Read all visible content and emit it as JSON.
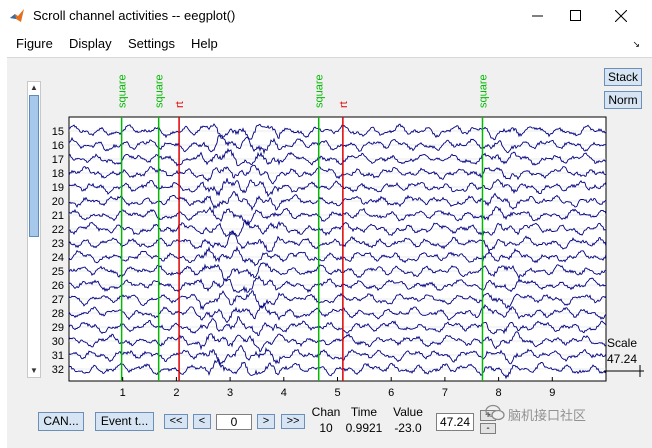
{
  "window": {
    "title": "Scroll channel activities -- eegplot()",
    "minimize_icon": "minimize-icon",
    "maximize_icon": "maximize-icon",
    "close_icon": "close-icon"
  },
  "menu": {
    "items": [
      "Figure",
      "Display",
      "Settings",
      "Help"
    ]
  },
  "side_buttons": {
    "stack": "Stack",
    "norm": "Norm"
  },
  "scale": {
    "label": "Scale",
    "value": "47.24"
  },
  "plot": {
    "channels": [
      "15",
      "16",
      "17",
      "18",
      "19",
      "20",
      "21",
      "22",
      "23",
      "24",
      "25",
      "26",
      "27",
      "28",
      "29",
      "30",
      "31",
      "32"
    ],
    "xticks": [
      "1",
      "2",
      "3",
      "4",
      "5",
      "6",
      "7",
      "8",
      "9"
    ],
    "xrange": [
      0,
      10
    ],
    "events": [
      {
        "type": "square",
        "t": 0.98,
        "color": "#00bb00"
      },
      {
        "type": "square",
        "t": 1.67,
        "color": "#00bb00"
      },
      {
        "type": "rt",
        "t": 2.05,
        "color": "#e00000"
      },
      {
        "type": "square",
        "t": 4.65,
        "color": "#00bb00"
      },
      {
        "type": "rt",
        "t": 5.1,
        "color": "#e00000"
      },
      {
        "type": "square",
        "t": 7.7,
        "color": "#00bb00"
      }
    ],
    "trace_color": "#000080",
    "grid_color": "#d8d8d8"
  },
  "controls": {
    "can_button": "CAN...",
    "event_button": "Event t...",
    "fast_back": "<<",
    "back": "<",
    "position_value": "0",
    "forward": ">",
    "fast_forward": ">>",
    "chan_label": "Chan",
    "chan_value": "10",
    "time_label": "Time",
    "time_value": "0.9921",
    "value_label": "Value",
    "value_value": "-23.0",
    "scale_field": "47.24",
    "spin_plus": "+",
    "spin_minus": "-"
  },
  "watermark": {
    "text": "脑机接口社区"
  }
}
